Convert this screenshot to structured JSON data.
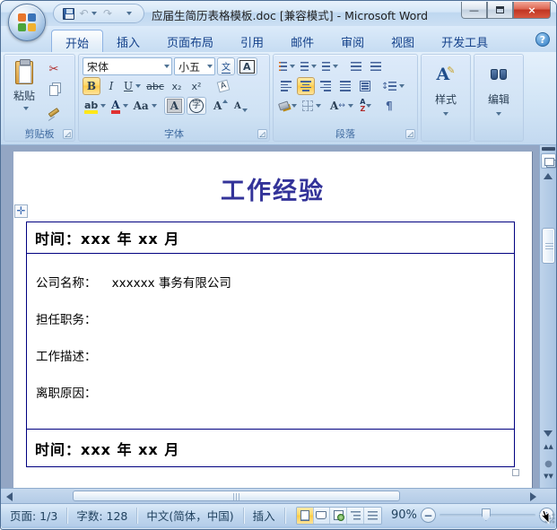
{
  "titlebar": {
    "title": "应届生简历表格模板.doc [兼容模式] - Microsoft Word"
  },
  "icons": {
    "undo": "↶",
    "redo": "↷",
    "cut": "✂",
    "minimize": "—",
    "close": "×",
    "help": "?",
    "pilcrow": "¶",
    "pinyin": "文",
    "char_border": "A",
    "styles_a": "A",
    "pencil": "✎",
    "ball": "●",
    "browse_up": "▲▲",
    "browse_down": "▼▼",
    "move_handle": "✛",
    "updown": "↕",
    "leftright": "↔",
    "minus": "−",
    "plus": "+"
  },
  "tabs": [
    {
      "label": "开始",
      "active": true
    },
    {
      "label": "插入",
      "active": false
    },
    {
      "label": "页面布局",
      "active": false
    },
    {
      "label": "引用",
      "active": false
    },
    {
      "label": "邮件",
      "active": false
    },
    {
      "label": "审阅",
      "active": false
    },
    {
      "label": "视图",
      "active": false
    },
    {
      "label": "开发工具",
      "active": false
    }
  ],
  "ribbon": {
    "clipboard": {
      "label": "剪贴板",
      "paste": "粘贴"
    },
    "font": {
      "label": "字体",
      "font_name": "宋体",
      "font_size": "小五",
      "bold": "B",
      "italic": "I",
      "underline": "U",
      "strikethrough": "abc",
      "subscript": "x₂",
      "superscript": "x²",
      "clear_format": "A",
      "highlight": "ab",
      "font_color": "A",
      "change_case": "Aa",
      "char_shading": "A",
      "enclose_char": "字",
      "grow_font": "A",
      "shrink_font": "A"
    },
    "paragraph": {
      "label": "段落",
      "sort_a": "A",
      "sort_z": "Z"
    },
    "styles": {
      "label": "样式"
    },
    "editing": {
      "label": "编辑"
    }
  },
  "document": {
    "title": "工作经验",
    "table": {
      "time_row_1": "时间：xxx 年 xx 月",
      "company": "公司名称：    xxxxxx 事务有限公司",
      "position": "担任职务：",
      "description": "工作描述：",
      "leave_reason": "离职原因：",
      "time_row_2": "时间：xxx 年 xx 月"
    }
  },
  "statusbar": {
    "page": "页面: 1/3",
    "words": "字数: 128",
    "language": "中文(简体，中国)",
    "insert_mode": "插入",
    "zoom": "90%"
  }
}
